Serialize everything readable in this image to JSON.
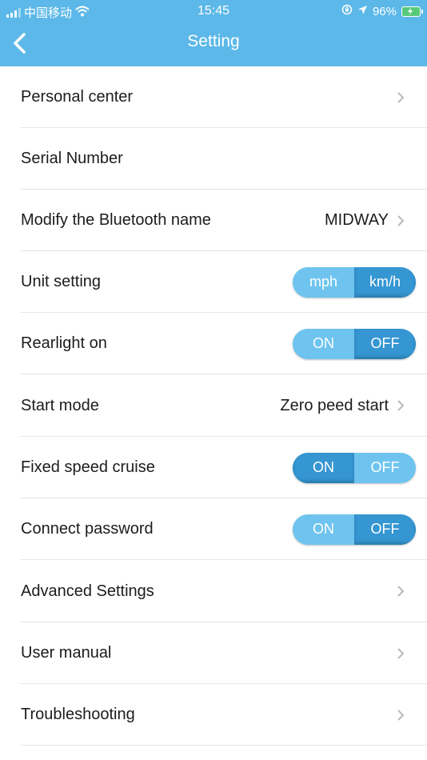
{
  "status_bar": {
    "carrier": "中国移动",
    "time": "15:45",
    "battery": "96%"
  },
  "header": {
    "title": "Setting"
  },
  "rows": [
    {
      "label": "Personal center"
    },
    {
      "label": "Serial Number"
    },
    {
      "label": "Modify the Bluetooth name",
      "value": "MIDWAY"
    },
    {
      "label": "Unit setting",
      "left": "mph",
      "right": "km/h",
      "selected": "right"
    },
    {
      "label": "Rearlight on",
      "left": "ON",
      "right": "OFF",
      "selected": "right"
    },
    {
      "label": "Start mode",
      "value": "Zero peed start"
    },
    {
      "label": "Fixed speed cruise",
      "left": "ON",
      "right": "OFF",
      "selected": "left"
    },
    {
      "label": "Connect password",
      "left": "ON",
      "right": "OFF",
      "selected": "right"
    },
    {
      "label": "Advanced Settings"
    },
    {
      "label": "User manual"
    },
    {
      "label": "Troubleshooting"
    }
  ],
  "colors": {
    "header_bg": "#5cb8e8",
    "toggle_bg": "#6ec4ef",
    "toggle_selected": "#3596d2"
  }
}
